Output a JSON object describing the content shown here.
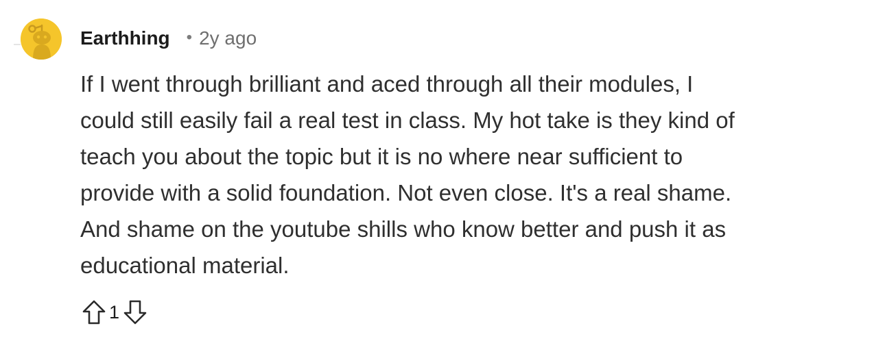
{
  "comment": {
    "author": "Earthhing",
    "separator": "•",
    "age": "2y ago",
    "avatar_icon": "snoo-avatar-icon",
    "avatar_color": "#f5c52b",
    "body_lines": [
      "If I went through brilliant and aced through all their modules, I",
      "could still easily fail a real test in class. My hot take is they kind of",
      "teach you about the topic but it is no where near sufficient to",
      "provide with a solid foundation. Not even close. It's a real shame.",
      "And shame on the youtube shills who know better and push it as",
      "educational material."
    ],
    "votes": {
      "upvote_icon": "upvote-arrow-icon",
      "score": "1",
      "downvote_icon": "downvote-arrow-icon"
    }
  }
}
